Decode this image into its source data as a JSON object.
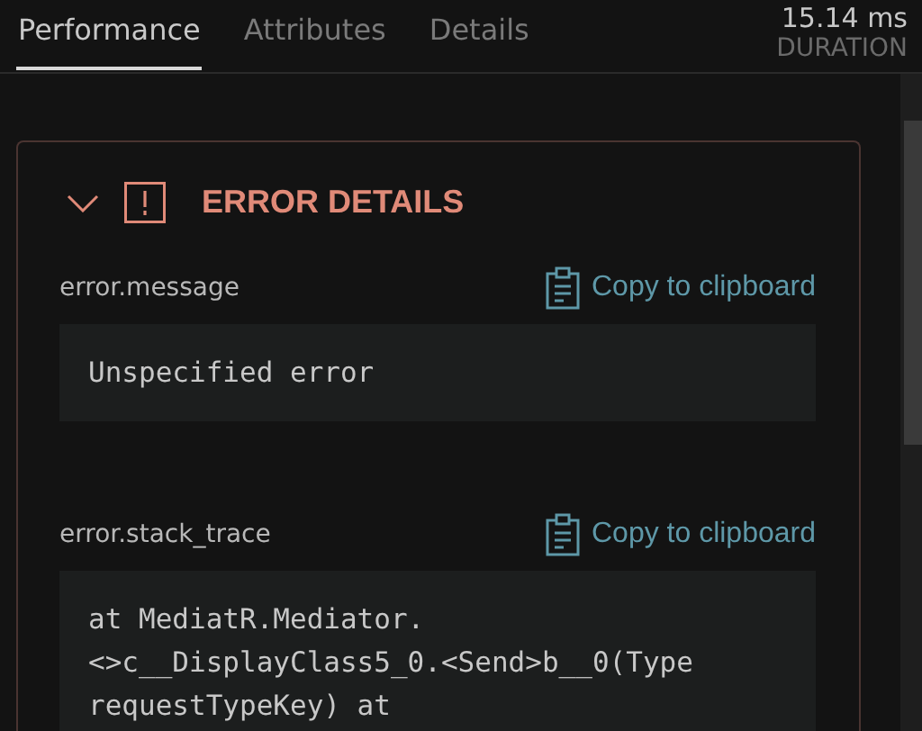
{
  "tabs": [
    {
      "label": "Performance",
      "selected": true
    },
    {
      "label": "Attributes",
      "selected": false
    },
    {
      "label": "Details",
      "selected": false
    }
  ],
  "duration": {
    "value": "15.14 ms",
    "label": "DURATION"
  },
  "panel": {
    "title": "ERROR DETAILS",
    "expanded": true,
    "fields": [
      {
        "name": "error.message",
        "action": "Copy to clipboard",
        "lines": [
          "Unspecified error"
        ]
      },
      {
        "name": "error.stack_trace",
        "action": "Copy to clipboard",
        "lines": [
          "at MediatR.Mediator.",
          "<>c__DisplayClass5_0.<Send>b__0(Type",
          "requestTypeKey) at"
        ]
      }
    ]
  }
}
